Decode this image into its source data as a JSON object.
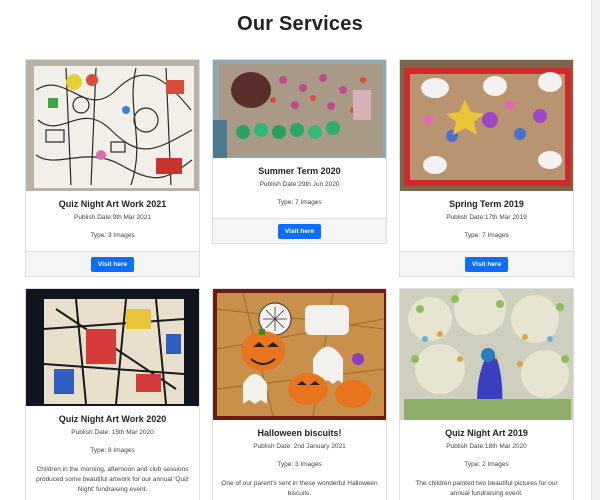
{
  "page": {
    "title": "Our Services"
  },
  "cards": [
    {
      "title": "Quiz Night Art Work 2021",
      "publish": "Publish Date:9th Mar 2021",
      "type": "Type: 3 Images",
      "button": "Visit here"
    },
    {
      "title": "Summer Term 2020",
      "publish": "Publish Date:29th Jun 2020",
      "type": "Type: 7 Images",
      "button": "Visit here"
    },
    {
      "title": "Spring Term 2019",
      "publish": "Publish Date:17th Mar 2019",
      "type": "Type: 7 Images",
      "button": "Visit here"
    },
    {
      "title": "Quiz Night Art Work 2020",
      "publish": "Publish Date: 15th Mar 2020",
      "type": "Type: 8 Images",
      "description": "Children in the morning, afternoon and club sessions produced some beautiful artwork for our annual 'Quiz Night' fundraising event."
    },
    {
      "title": "Halloween biscuits!",
      "publish": "Publish Date: 2nd January 2021",
      "type": "Type: 3 Images",
      "description": "One of our parent's sent in these wonderful Halloween biscuits."
    },
    {
      "title": "Quiz Night Art 2019",
      "publish": "Publish Date:18th Mar 2020",
      "type": "Type: 2 Images",
      "description": "The children painted two beautiful pictures for our annual fundraising event."
    }
  ],
  "colors": {
    "button": "#0d6efd",
    "card_border": "#dedede",
    "footer_bg": "#f5f5f5"
  }
}
